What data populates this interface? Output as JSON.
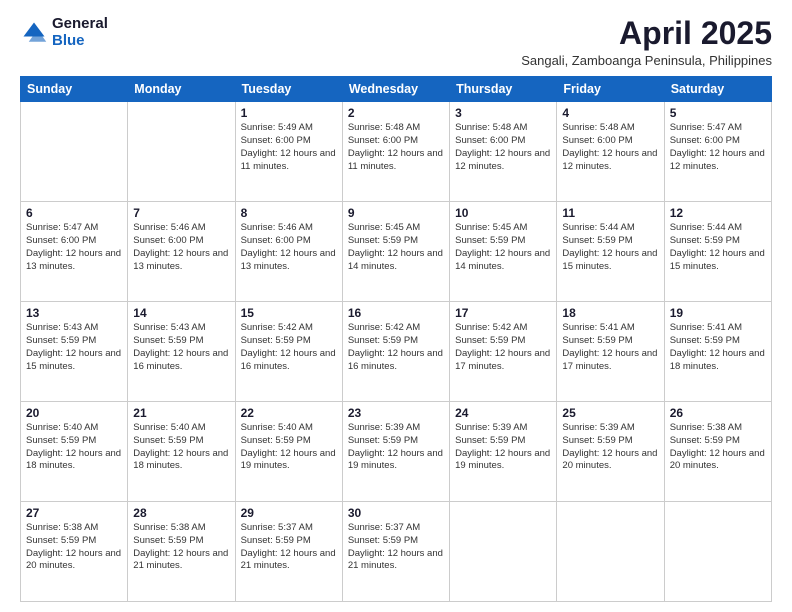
{
  "logo": {
    "general": "General",
    "blue": "Blue"
  },
  "header": {
    "title": "April 2025",
    "subtitle": "Sangali, Zamboanga Peninsula, Philippines"
  },
  "days_of_week": [
    "Sunday",
    "Monday",
    "Tuesday",
    "Wednesday",
    "Thursday",
    "Friday",
    "Saturday"
  ],
  "weeks": [
    [
      {
        "day": "",
        "info": ""
      },
      {
        "day": "",
        "info": ""
      },
      {
        "day": "1",
        "info": "Sunrise: 5:49 AM\nSunset: 6:00 PM\nDaylight: 12 hours and 11 minutes."
      },
      {
        "day": "2",
        "info": "Sunrise: 5:48 AM\nSunset: 6:00 PM\nDaylight: 12 hours and 11 minutes."
      },
      {
        "day": "3",
        "info": "Sunrise: 5:48 AM\nSunset: 6:00 PM\nDaylight: 12 hours and 12 minutes."
      },
      {
        "day": "4",
        "info": "Sunrise: 5:48 AM\nSunset: 6:00 PM\nDaylight: 12 hours and 12 minutes."
      },
      {
        "day": "5",
        "info": "Sunrise: 5:47 AM\nSunset: 6:00 PM\nDaylight: 12 hours and 12 minutes."
      }
    ],
    [
      {
        "day": "6",
        "info": "Sunrise: 5:47 AM\nSunset: 6:00 PM\nDaylight: 12 hours and 13 minutes."
      },
      {
        "day": "7",
        "info": "Sunrise: 5:46 AM\nSunset: 6:00 PM\nDaylight: 12 hours and 13 minutes."
      },
      {
        "day": "8",
        "info": "Sunrise: 5:46 AM\nSunset: 6:00 PM\nDaylight: 12 hours and 13 minutes."
      },
      {
        "day": "9",
        "info": "Sunrise: 5:45 AM\nSunset: 5:59 PM\nDaylight: 12 hours and 14 minutes."
      },
      {
        "day": "10",
        "info": "Sunrise: 5:45 AM\nSunset: 5:59 PM\nDaylight: 12 hours and 14 minutes."
      },
      {
        "day": "11",
        "info": "Sunrise: 5:44 AM\nSunset: 5:59 PM\nDaylight: 12 hours and 15 minutes."
      },
      {
        "day": "12",
        "info": "Sunrise: 5:44 AM\nSunset: 5:59 PM\nDaylight: 12 hours and 15 minutes."
      }
    ],
    [
      {
        "day": "13",
        "info": "Sunrise: 5:43 AM\nSunset: 5:59 PM\nDaylight: 12 hours and 15 minutes."
      },
      {
        "day": "14",
        "info": "Sunrise: 5:43 AM\nSunset: 5:59 PM\nDaylight: 12 hours and 16 minutes."
      },
      {
        "day": "15",
        "info": "Sunrise: 5:42 AM\nSunset: 5:59 PM\nDaylight: 12 hours and 16 minutes."
      },
      {
        "day": "16",
        "info": "Sunrise: 5:42 AM\nSunset: 5:59 PM\nDaylight: 12 hours and 16 minutes."
      },
      {
        "day": "17",
        "info": "Sunrise: 5:42 AM\nSunset: 5:59 PM\nDaylight: 12 hours and 17 minutes."
      },
      {
        "day": "18",
        "info": "Sunrise: 5:41 AM\nSunset: 5:59 PM\nDaylight: 12 hours and 17 minutes."
      },
      {
        "day": "19",
        "info": "Sunrise: 5:41 AM\nSunset: 5:59 PM\nDaylight: 12 hours and 18 minutes."
      }
    ],
    [
      {
        "day": "20",
        "info": "Sunrise: 5:40 AM\nSunset: 5:59 PM\nDaylight: 12 hours and 18 minutes."
      },
      {
        "day": "21",
        "info": "Sunrise: 5:40 AM\nSunset: 5:59 PM\nDaylight: 12 hours and 18 minutes."
      },
      {
        "day": "22",
        "info": "Sunrise: 5:40 AM\nSunset: 5:59 PM\nDaylight: 12 hours and 19 minutes."
      },
      {
        "day": "23",
        "info": "Sunrise: 5:39 AM\nSunset: 5:59 PM\nDaylight: 12 hours and 19 minutes."
      },
      {
        "day": "24",
        "info": "Sunrise: 5:39 AM\nSunset: 5:59 PM\nDaylight: 12 hours and 19 minutes."
      },
      {
        "day": "25",
        "info": "Sunrise: 5:39 AM\nSunset: 5:59 PM\nDaylight: 12 hours and 20 minutes."
      },
      {
        "day": "26",
        "info": "Sunrise: 5:38 AM\nSunset: 5:59 PM\nDaylight: 12 hours and 20 minutes."
      }
    ],
    [
      {
        "day": "27",
        "info": "Sunrise: 5:38 AM\nSunset: 5:59 PM\nDaylight: 12 hours and 20 minutes."
      },
      {
        "day": "28",
        "info": "Sunrise: 5:38 AM\nSunset: 5:59 PM\nDaylight: 12 hours and 21 minutes."
      },
      {
        "day": "29",
        "info": "Sunrise: 5:37 AM\nSunset: 5:59 PM\nDaylight: 12 hours and 21 minutes."
      },
      {
        "day": "30",
        "info": "Sunrise: 5:37 AM\nSunset: 5:59 PM\nDaylight: 12 hours and 21 minutes."
      },
      {
        "day": "",
        "info": ""
      },
      {
        "day": "",
        "info": ""
      },
      {
        "day": "",
        "info": ""
      }
    ]
  ]
}
